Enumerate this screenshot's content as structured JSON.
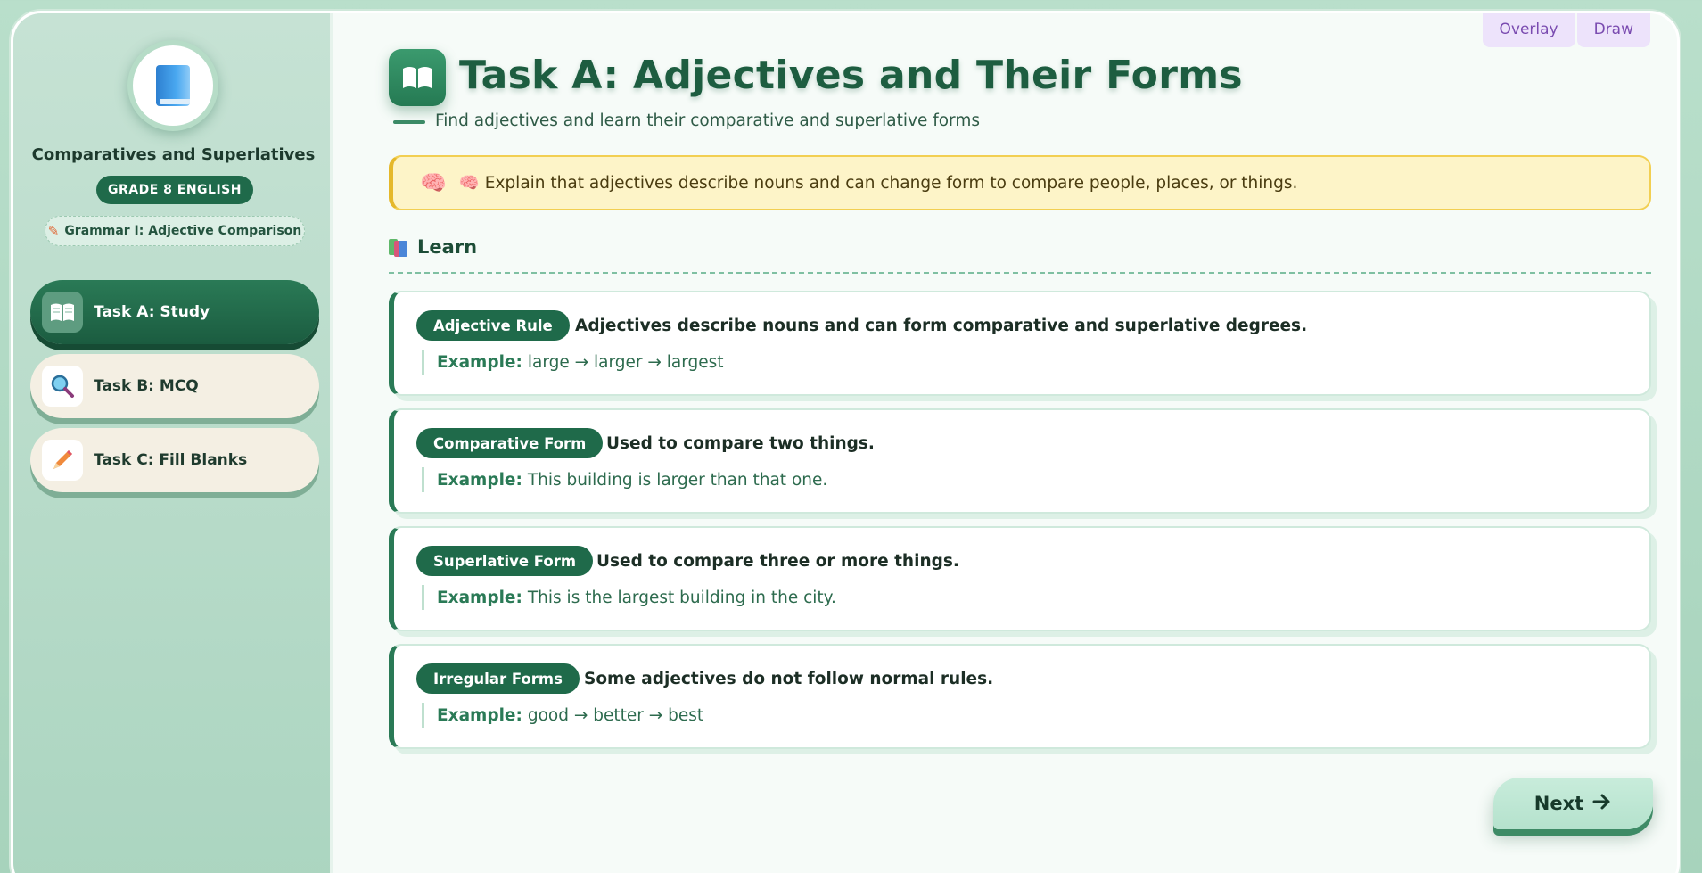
{
  "tools": {
    "overlay": "Overlay",
    "draw": "Draw"
  },
  "sidebar": {
    "title": "Comparatives and Superlatives",
    "grade": "GRADE 8 ENGLISH",
    "topic": "Grammar I: Adjective Comparison",
    "items": [
      {
        "label": "Task A: Study",
        "icon": "open-book-icon",
        "active": true
      },
      {
        "label": "Task B: MCQ",
        "icon": "magnifier-icon",
        "active": false
      },
      {
        "label": "Task C: Fill Blanks",
        "icon": "pencil-icon",
        "active": false
      }
    ]
  },
  "main": {
    "title": "Task A: Adjectives and Their Forms",
    "subtitle": "Find adjectives and learn their comparative and superlative forms",
    "tip": "🧠 Explain that adjectives describe nouns and can change form to compare people, places, or things.",
    "learn_heading": "Learn",
    "cards": [
      {
        "tag": "Adjective Rule",
        "desc": "Adjectives describe nouns and can form comparative and superlative degrees.",
        "example_label": "Example:",
        "example": "large → larger → largest"
      },
      {
        "tag": "Comparative Form",
        "desc": "Used to compare two things.",
        "example_label": "Example:",
        "example": "This building is larger than that one."
      },
      {
        "tag": "Superlative Form",
        "desc": "Used to compare three or more things.",
        "example_label": "Example:",
        "example": "This is the largest building in the city."
      },
      {
        "tag": "Irregular Forms",
        "desc": "Some adjectives do not follow normal rules.",
        "example_label": "Example:",
        "example": "good → better → best"
      }
    ],
    "next_label": "Next"
  },
  "colors": {
    "accent": "#1f6a4a",
    "tip_bg": "#fdf4c8",
    "tip_border": "#f2cf52",
    "sidebar_bg": "#c6e2d4"
  }
}
